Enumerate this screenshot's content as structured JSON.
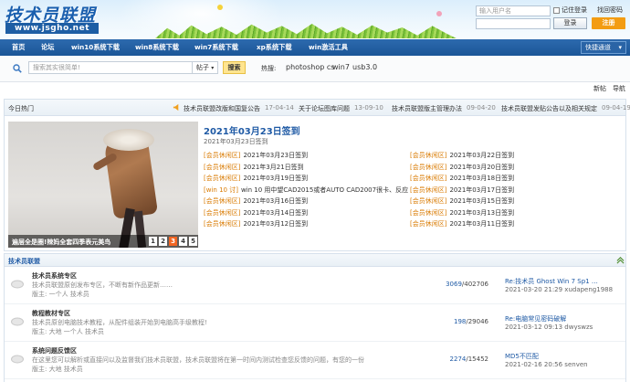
{
  "header": {
    "logo_title": "技术员联盟",
    "logo_url": "www.jsgho.net",
    "username_placeholder": "输入用户名",
    "password_placeholder": "",
    "remember_label": "记住登录",
    "find_password": "找回密码",
    "login_label": "登录",
    "register_label": "注册"
  },
  "nav": {
    "items": [
      "首页",
      "论坛",
      "win10系统下载",
      "win8系统下载",
      "win7系统下载",
      "xp系统下载",
      "win激活工具"
    ],
    "quick_label": "快捷通道"
  },
  "search": {
    "placeholder": "搜索其实很简单!",
    "type": "帖子",
    "button": "搜索",
    "hot_label": "热搜:",
    "hot_items": [
      "photoshop cs",
      "win7",
      "usb3.0"
    ]
  },
  "toolbar": {
    "new_post": "新帖",
    "nav_link": "导航"
  },
  "hot": {
    "title": "今日热门",
    "announcements": [
      {
        "text": "技术员联盟改版和国复公告",
        "date": "17-04-14"
      },
      {
        "text": "关于论坛图库问题",
        "date": "13-09-10"
      },
      {
        "text": "技术员联盟版主管理办法",
        "date": "09-04-20"
      },
      {
        "text": "技术员联盟发贴公告以及相关规定",
        "date": "09-04-19"
      }
    ],
    "slide_caption": "遍层全是圈!辣妈全套四季表元美鸟",
    "slide_pages": [
      "1",
      "2",
      "3",
      "4",
      "5"
    ],
    "slide_active": 3,
    "sign_title": "2021年03月23日签到",
    "sign_sub": "2021年03月23日签到",
    "left_rows": [
      {
        "tag": "[会员休闲区]",
        "text": "2021年03月23日签到"
      },
      {
        "tag": "[会员休闲区]",
        "text": "2021年3月21日签到"
      },
      {
        "tag": "[会员休闲区]",
        "text": "2021年03月19日签到"
      },
      {
        "tag": "[win 10 讨]",
        "text": "win 10 用中望CAD2015或者AUTO CAD2007很卡、反应"
      },
      {
        "tag": "[会员休闲区]",
        "text": "2021年03月16日签到"
      },
      {
        "tag": "[会员休闲区]",
        "text": "2021年03月14日签到"
      },
      {
        "tag": "[会员休闲区]",
        "text": "2021年03月12日签到"
      }
    ],
    "right_rows": [
      {
        "tag": "[会员休闲区]",
        "text": "2021年03月22日签到"
      },
      {
        "tag": "[会员休闲区]",
        "text": "2021年03月20日签到"
      },
      {
        "tag": "[会员休闲区]",
        "text": "2021年03月18日签到"
      },
      {
        "tag": "[会员休闲区]",
        "text": "2021年03月17日签到"
      },
      {
        "tag": "[会员休闲区]",
        "text": "2021年03月15日签到"
      },
      {
        "tag": "[会员休闲区]",
        "text": "2021年03月13日签到"
      },
      {
        "tag": "[会员休闲区]",
        "text": "2021年03月11日签到"
      }
    ]
  },
  "forum": {
    "title": "技术员联盟",
    "rows": [
      {
        "name": "技术员系统专区",
        "desc": "技术员联盟原创发布专区，不断有新作品更新……",
        "mod": "版主: 一个人 技术员",
        "threads": "3069",
        "posts": "402706",
        "last_title": "Re:技术员 Ghost Win 7 Sp1 …",
        "last_time": "2021-03-20 21:29 xudapeng1988"
      },
      {
        "name": "教程教材专区",
        "desc": "技术员原创电脑技术教程，从配件组装开始到电脑高手级教程!",
        "mod": "版主: 大地 一个人 技术员",
        "threads": "198",
        "posts": "29046",
        "last_title": "Re:电脑常见密码破解",
        "last_time": "2021-03-12 09:13 dwyswzs"
      },
      {
        "name": "系统问题反馈区",
        "desc": "在这里您可以解析或直接问以及监督我们技术员联盟，技术员联盟将在第一时间内测试检查您反馈的问题，有您的一份",
        "mod": "版主: 大地 技术员",
        "threads": "2274",
        "posts": "15452",
        "last_title": "MD5不匹配",
        "last_time": "2021-02-16 20:56 senven"
      }
    ]
  }
}
